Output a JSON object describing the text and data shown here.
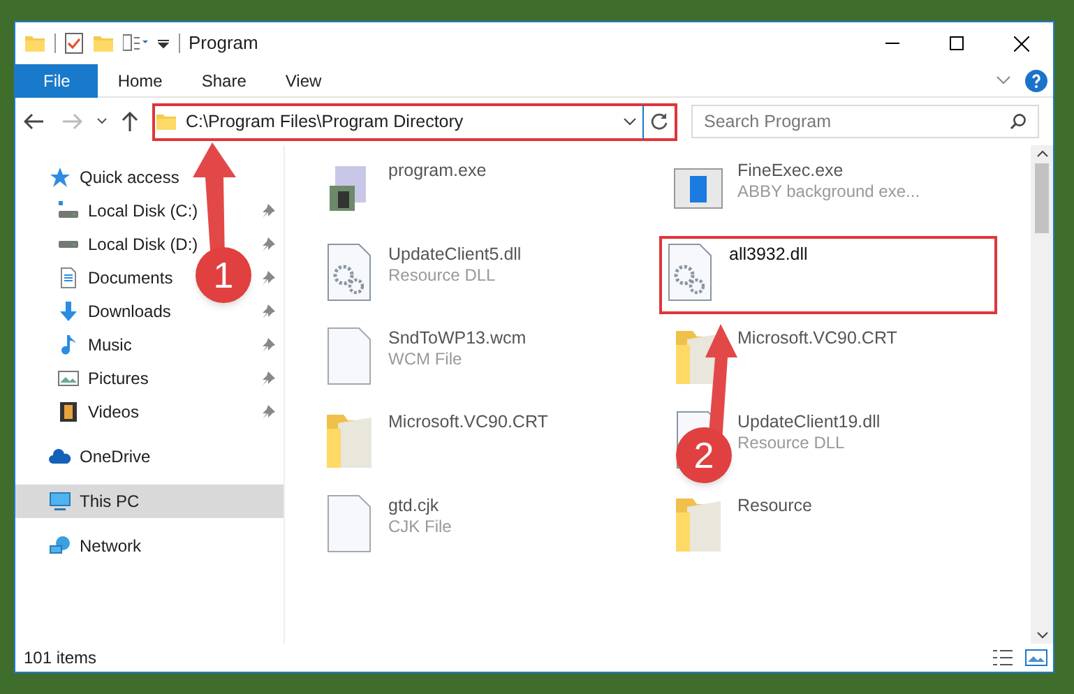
{
  "window": {
    "title": "Program"
  },
  "ribbon_tabs": [
    {
      "label": "File",
      "selected": true
    },
    {
      "label": "Home",
      "selected": false
    },
    {
      "label": "Share",
      "selected": false
    },
    {
      "label": "View",
      "selected": false
    }
  ],
  "address": {
    "path": "C:\\Program Files\\Program Directory",
    "highlighted": true
  },
  "search": {
    "placeholder": "Search Program"
  },
  "navigation": [
    {
      "label": "Quick access",
      "kind": "star",
      "selected": false,
      "children": [
        {
          "label": "Local Disk (C:)",
          "kind": "disk-c",
          "pinned": true
        },
        {
          "label": "Local Disk (D:)",
          "kind": "disk",
          "pinned": true
        },
        {
          "label": "Documents",
          "kind": "docs",
          "pinned": true
        },
        {
          "label": "Downloads",
          "kind": "downloads",
          "pinned": true
        },
        {
          "label": "Music",
          "kind": "music",
          "pinned": true
        },
        {
          "label": "Pictures",
          "kind": "pictures",
          "pinned": true
        },
        {
          "label": "Videos",
          "kind": "videos",
          "pinned": true
        }
      ]
    },
    {
      "label": "OneDrive",
      "kind": "cloud",
      "selected": false
    },
    {
      "label": "This PC",
      "kind": "pc",
      "selected": true
    },
    {
      "label": "Network",
      "kind": "network",
      "selected": false
    }
  ],
  "files": [
    {
      "name": "program.exe",
      "kind": "exe",
      "highlighted": false
    },
    {
      "name": "FineExec.exe",
      "description": "ABBY background exe...",
      "kind": "app",
      "highlighted": false
    },
    {
      "name": "UpdateClient5.dll",
      "description": "Resource DLL",
      "kind": "dll",
      "highlighted": false
    },
    {
      "name": "all3932.dll",
      "kind": "dll",
      "highlighted": true
    },
    {
      "name": "SndToWP13.wcm",
      "description": "WCM File",
      "kind": "file",
      "highlighted": false
    },
    {
      "name": "Microsoft.VC90.CRT",
      "kind": "folder",
      "highlighted": false
    },
    {
      "name": "Microsoft.VC90.CRT",
      "kind": "folder",
      "highlighted": false
    },
    {
      "name": "UpdateClient19.dll",
      "description": "Resource DLL",
      "kind": "dll",
      "highlighted": false
    },
    {
      "name": "gtd.cjk",
      "description": "CJK File",
      "kind": "file",
      "highlighted": false
    },
    {
      "name": "Resource",
      "kind": "folder",
      "highlighted": false
    }
  ],
  "status_bar": {
    "item_count": "101 items"
  },
  "callouts": [
    {
      "label": "1"
    },
    {
      "label": "2"
    }
  ]
}
